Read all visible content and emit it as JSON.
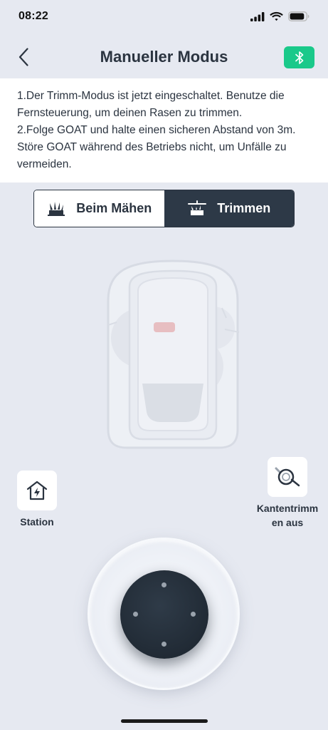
{
  "status_bar": {
    "time": "08:22",
    "battery_level": 0.9
  },
  "header": {
    "title": "Manueller Modus",
    "accent_color": "#1ac98a"
  },
  "info": {
    "lines": [
      "1.Der Trimm-Modus ist jetzt eingeschaltet. Benutze die",
      "Fernsteuerung, um deinen Rasen zu trimmen.",
      "2.Folge GOAT und halte einen sicheren Abstand von 3m.",
      "Störe GOAT während des Betriebs nicht, um Unfälle zu",
      "vermeiden."
    ]
  },
  "mode_toggle": {
    "options": [
      {
        "label": "Beim Mähen",
        "icon": "mowing-grass-icon",
        "selected": false
      },
      {
        "label": "Trimmen",
        "icon": "trimming-grass-icon",
        "selected": true
      }
    ]
  },
  "station_button": {
    "label": "Station",
    "icon": "home-charging-icon"
  },
  "edge_trim_button": {
    "label_line1": "Kantentrimm",
    "label_line2": "en aus",
    "icon": "edge-trimmer-icon"
  },
  "joystick": {
    "icon": "joystick-icon"
  }
}
